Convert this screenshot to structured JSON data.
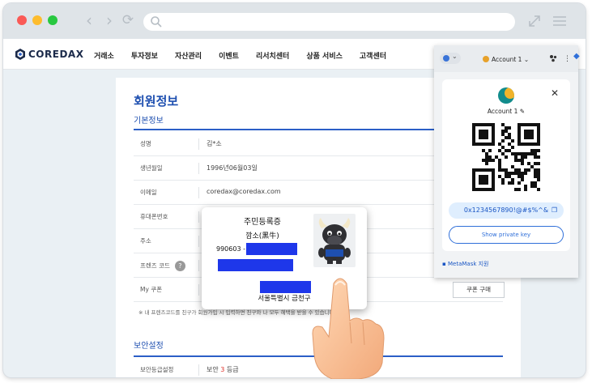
{
  "browser": {
    "url": "",
    "nav_back": "‹",
    "nav_forward": "›",
    "nav_reload": "⟳"
  },
  "site": {
    "logo": "COREDAX",
    "menu": [
      "거래소",
      "투자정보",
      "자산관리",
      "이벤트",
      "리서치센터",
      "상품 서비스",
      "고객센터"
    ]
  },
  "profile": {
    "page_title": "회원정보",
    "section_basic": "기본정보",
    "rows": [
      {
        "label": "성명",
        "value": "김*소"
      },
      {
        "label": "생년월일",
        "value": "1996년06월03일"
      },
      {
        "label": "이메일",
        "value": "coredax@coredax.com"
      },
      {
        "label": "휴대폰번호",
        "value": ""
      },
      {
        "label": "주소",
        "value": ""
      },
      {
        "label": "프렌즈 코드",
        "value": ""
      },
      {
        "label": "My 쿠폰",
        "value": ""
      }
    ],
    "help_glyph": "?",
    "coupon_button": "쿠폰 구매",
    "note": "※ 내 프렌즈코드를 친구가 회원가입 시 입력하면 친구와 나 모두 혜택을 받을 수 있습니다.",
    "section_security": "보안설정",
    "security_rows": [
      {
        "label": "보안등급설정",
        "value_prefix": "보안 ",
        "value_level": "3",
        "value_suffix": " 등급"
      }
    ]
  },
  "id_card": {
    "title": "주민등록증",
    "name": "깜소(黑牛)",
    "number_prefix": "990603 -",
    "address": "서울특별시 금천구"
  },
  "metamask": {
    "network_glyph": "⌄",
    "account_label": "Account 1",
    "account_chevron": "⌄",
    "account_name": "Account 1",
    "edit_glyph": "✎",
    "close_glyph": "✕",
    "menu_glyph": "⋮",
    "address": "0x1234567890!@#$%^&",
    "copy_glyph": "❐",
    "show_private_key": "Show private key",
    "support": "MetaMask 지원"
  },
  "colors": {
    "brand_blue": "#1e4fb0",
    "redaction": "#1e37ea",
    "metamask_blue": "#2f6fd9"
  }
}
